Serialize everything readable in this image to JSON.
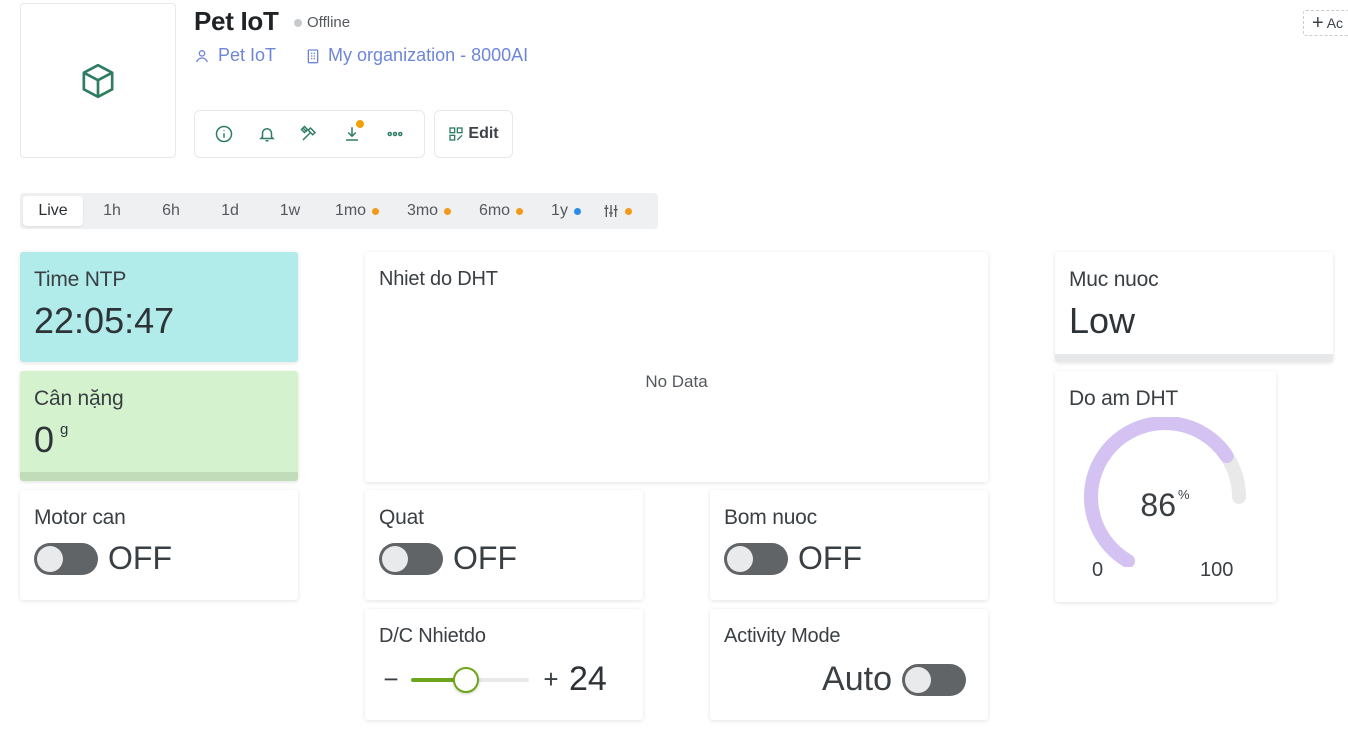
{
  "header": {
    "title": "Pet IoT",
    "status": "Offline",
    "template_link": "Pet IoT",
    "org_link": "My organization - 8000AI",
    "edit_label": "Edit",
    "add_label": "Ac"
  },
  "tabs": [
    {
      "label": "Live"
    },
    {
      "label": "1h"
    },
    {
      "label": "6h"
    },
    {
      "label": "1d"
    },
    {
      "label": "1w"
    },
    {
      "label": "1mo"
    },
    {
      "label": "3mo"
    },
    {
      "label": "6mo"
    },
    {
      "label": "1y"
    }
  ],
  "widgets": {
    "time": {
      "label": "Time NTP",
      "value": "22:05:47"
    },
    "weight": {
      "label": "Cân nặng",
      "value": "0",
      "unit": "g"
    },
    "chart": {
      "label": "Nhiet do DHT",
      "empty": "No Data"
    },
    "level": {
      "label": "Muc nuoc",
      "value": "Low"
    },
    "humidity": {
      "label": "Do am DHT",
      "value": "86",
      "unit": "%",
      "min": "0",
      "max": "100",
      "fraction": 0.86
    },
    "motor": {
      "label": "Motor can",
      "state": "OFF"
    },
    "fan": {
      "label": "Quat",
      "state": "OFF"
    },
    "pump": {
      "label": "Bom nuoc",
      "state": "OFF"
    },
    "temp_setpoint": {
      "label": "D/C Nhietdo",
      "value": "24",
      "minus": "−",
      "plus": "+",
      "fraction": 0.47
    },
    "mode": {
      "label": "Activity Mode",
      "value": "Auto"
    }
  },
  "colors": {
    "accent": "#2f7d61",
    "link": "#6d86d8",
    "time_bg": "#b1ebea",
    "weight_bg": "#d4f2cd",
    "gauge": "#d4c3f2",
    "slider": "#6da51d"
  }
}
